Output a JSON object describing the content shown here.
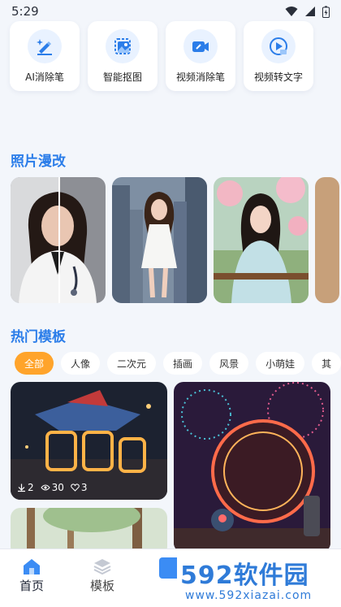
{
  "status_bar": {
    "time": "5:29"
  },
  "tools": [
    {
      "label": "AI消除笔",
      "icon": "eraser-pen-icon"
    },
    {
      "label": "智能抠图",
      "icon": "cutout-icon"
    },
    {
      "label": "视频消除笔",
      "icon": "video-eraser-icon"
    },
    {
      "label": "视频转文字",
      "icon": "video-to-text-icon"
    }
  ],
  "photo_section": {
    "title": "照片漫改",
    "cards": [
      {
        "name": "doctor-before-after"
      },
      {
        "name": "city-dress-girl"
      },
      {
        "name": "blossom-hanfu-girl"
      }
    ]
  },
  "template_section": {
    "title": "热门模板",
    "chips": [
      "全部",
      "人像",
      "二次元",
      "插画",
      "风景",
      "小萌娃",
      "其"
    ],
    "active_chip": "全部",
    "cards": [
      {
        "name": "mecha-2025",
        "stats": {
          "downloads": "2",
          "views": "30",
          "likes": "3"
        }
      },
      {
        "name": "fireworks-2025"
      },
      {
        "name": "forest-scene"
      }
    ]
  },
  "nav": {
    "home": "首页",
    "templates": "模板"
  },
  "watermark": {
    "brand": "592软件园",
    "url": "www.592xiazai.com"
  },
  "colors": {
    "accent": "#2b7de9",
    "chip_active": "#ffa42b",
    "background": "#f3f6fb"
  }
}
